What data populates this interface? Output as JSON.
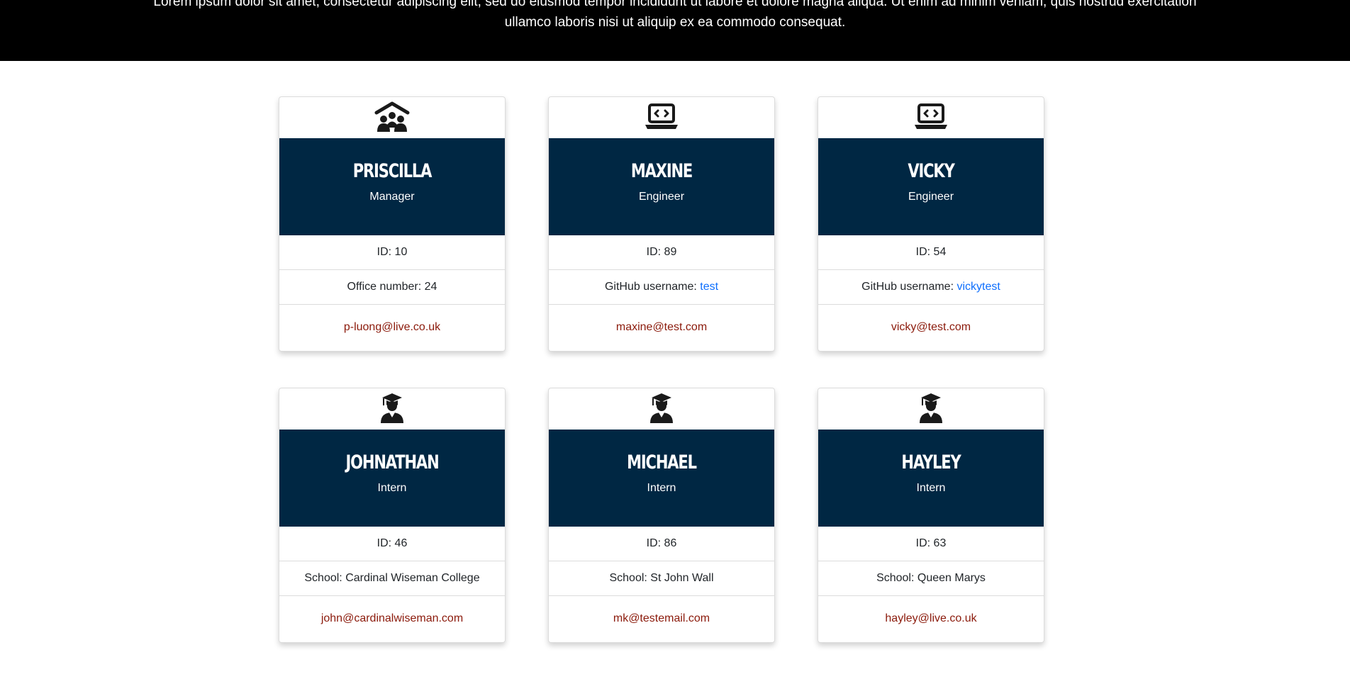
{
  "hero": {
    "text": "Lorem ipsum dolor sit amet, consectetur adipiscing elit, sed do eiusmod tempor incididunt ut labore et dolore magna aliqua. Ut enim ad minim veniam, quis nostrud exercitation ullamco laboris nisi ut aliquip ex ea commodo consequat."
  },
  "colors": {
    "header_bg": "#002743",
    "email": "#8b1a0b",
    "github_link": "#0d6efd"
  },
  "cards": [
    {
      "icon": "manager-icon",
      "name": "Priscilla",
      "role": "Manager",
      "id_text": "ID: 10",
      "detail_label": "Office number: 24",
      "detail_link": "",
      "email": "p-luong@live.co.uk"
    },
    {
      "icon": "laptop-code-icon",
      "name": "Maxine",
      "role": "Engineer",
      "id_text": "ID: 89",
      "detail_label": "GitHub username: ",
      "detail_link": "test",
      "email": "maxine@test.com"
    },
    {
      "icon": "laptop-code-icon",
      "name": "Vicky",
      "role": "Engineer",
      "id_text": "ID: 54",
      "detail_label": "GitHub username: ",
      "detail_link": "vickytest",
      "email": "vicky@test.com"
    },
    {
      "icon": "graduate-icon",
      "name": "Johnathan",
      "role": "Intern",
      "id_text": "ID: 46",
      "detail_label": "School: Cardinal Wiseman College",
      "detail_link": "",
      "email": "john@cardinalwiseman.com"
    },
    {
      "icon": "graduate-icon",
      "name": "Michael",
      "role": "Intern",
      "id_text": "ID: 86",
      "detail_label": "School: St John Wall",
      "detail_link": "",
      "email": "mk@testemail.com"
    },
    {
      "icon": "graduate-icon",
      "name": "Hayley",
      "role": "Intern",
      "id_text": "ID: 63",
      "detail_label": "School: Queen Marys",
      "detail_link": "",
      "email": "hayley@live.co.uk"
    }
  ]
}
